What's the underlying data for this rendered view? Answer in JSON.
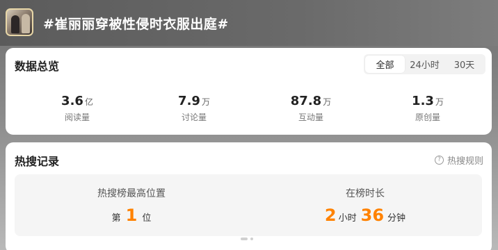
{
  "topic": {
    "title": "#崔丽丽穿被性侵时衣服出庭#"
  },
  "overview": {
    "title": "数据总览",
    "tabs": [
      "全部",
      "24小时",
      "30天"
    ],
    "active_tab": "全部",
    "stats": [
      {
        "value": "3.6",
        "unit": "亿",
        "label": "阅读量"
      },
      {
        "value": "7.9",
        "unit": "万",
        "label": "讨论量"
      },
      {
        "value": "87.8",
        "unit": "万",
        "label": "互动量"
      },
      {
        "value": "1.3",
        "unit": "万",
        "label": "原创量"
      }
    ]
  },
  "hot": {
    "title": "热搜记录",
    "rules_label": "热搜规则",
    "highest": {
      "heading": "热搜榜最高位置",
      "prefix": "第",
      "rank": "1",
      "suffix": "位"
    },
    "duration": {
      "heading": "在榜时长",
      "hours": "2",
      "hours_unit": "小时",
      "minutes": "36",
      "minutes_unit": "分钟"
    }
  },
  "colors": {
    "accent": "#ff8200",
    "card": "#ffffff",
    "panel": "#f5f5f5"
  }
}
